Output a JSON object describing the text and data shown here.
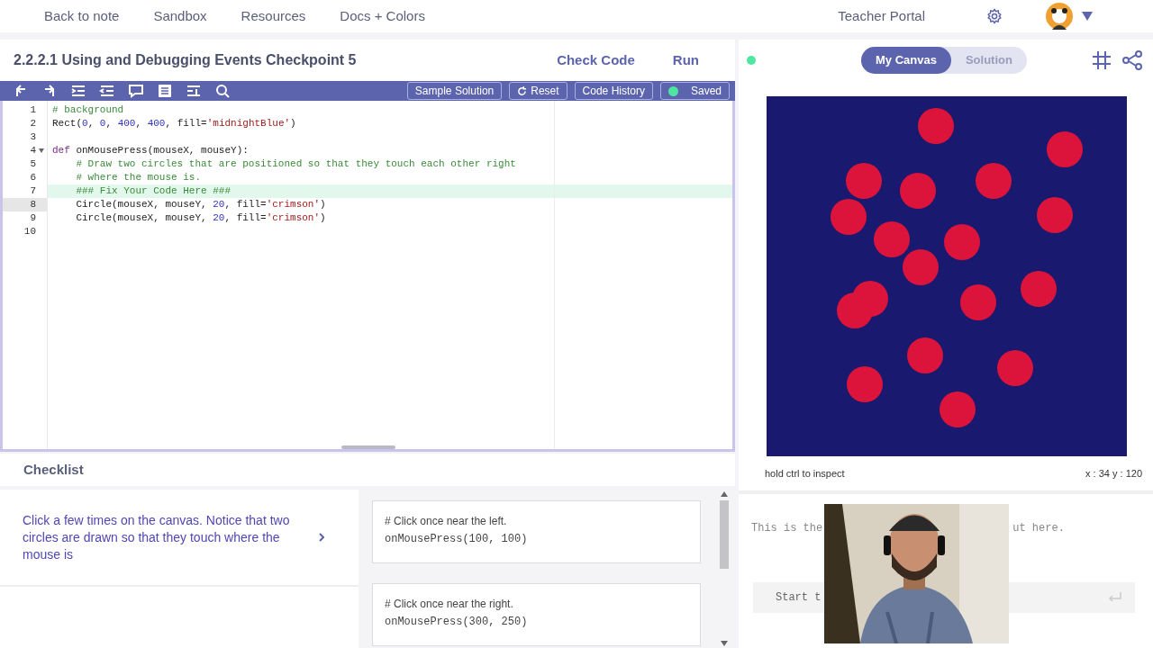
{
  "nav": {
    "links": [
      "Back to note",
      "Sandbox",
      "Resources",
      "Docs + Colors"
    ],
    "teacher_portal": "Teacher Portal"
  },
  "title": "2.2.2.1 Using and Debugging Events Checkpoint 5",
  "actions": [
    "Check Code",
    "Run"
  ],
  "toolbar": {
    "buttons": [
      {
        "label": "Sample Solution",
        "kind": "plain"
      },
      {
        "label": "Reset",
        "kind": "reset"
      },
      {
        "label": "Code History",
        "kind": "plain"
      },
      {
        "label": "Saved",
        "kind": "status"
      }
    ]
  },
  "editor": {
    "lines": [
      {
        "number": "1",
        "highlighted": false,
        "current": false,
        "foldable": false,
        "segments": [
          {
            "t": "# background",
            "kind": "comment"
          }
        ]
      },
      {
        "number": "2",
        "highlighted": false,
        "current": false,
        "foldable": false,
        "segments": [
          {
            "t": "Rect(",
            "kind": "plain"
          },
          {
            "t": "0",
            "kind": "number"
          },
          {
            "t": ", ",
            "kind": "plain"
          },
          {
            "t": "0",
            "kind": "number"
          },
          {
            "t": ", ",
            "kind": "plain"
          },
          {
            "t": "400",
            "kind": "number"
          },
          {
            "t": ", ",
            "kind": "plain"
          },
          {
            "t": "400",
            "kind": "number"
          },
          {
            "t": ", fill=",
            "kind": "plain"
          },
          {
            "t": "'midnightBlue'",
            "kind": "string"
          },
          {
            "t": ")",
            "kind": "plain"
          }
        ]
      },
      {
        "number": "3",
        "highlighted": false,
        "current": false,
        "foldable": false
      },
      {
        "number": "4",
        "highlighted": false,
        "current": false,
        "foldable": true,
        "segments": [
          {
            "t": "def",
            "kind": "keyword"
          },
          {
            "t": " onMousePress(mouseX, mouseY):",
            "kind": "plain"
          }
        ]
      },
      {
        "number": "5",
        "highlighted": false,
        "current": false,
        "foldable": false,
        "segments": [
          {
            "t": "    # Draw two circles that are positioned so that they touch each other right",
            "kind": "comment"
          }
        ]
      },
      {
        "number": "6",
        "highlighted": false,
        "current": false,
        "foldable": false,
        "segments": [
          {
            "t": "    # where the mouse is.",
            "kind": "comment"
          }
        ]
      },
      {
        "number": "7",
        "highlighted": true,
        "current": false,
        "foldable": false,
        "segments": [
          {
            "t": "    ### Fix Your Code Here ###",
            "kind": "comment"
          }
        ]
      },
      {
        "number": "8",
        "highlighted": false,
        "current": true,
        "foldable": false,
        "segments": [
          {
            "t": "    Circle(mouseX, mouseY, ",
            "kind": "plain"
          },
          {
            "t": "20",
            "kind": "number"
          },
          {
            "t": ", fill=",
            "kind": "plain"
          },
          {
            "t": "'crimson'",
            "kind": "string"
          },
          {
            "t": ")",
            "kind": "plain"
          }
        ]
      },
      {
        "number": "9",
        "highlighted": false,
        "current": false,
        "foldable": false,
        "segments": [
          {
            "t": "    Circle(mouseX, mouseY, ",
            "kind": "plain"
          },
          {
            "t": "20",
            "kind": "number"
          },
          {
            "t": ", fill=",
            "kind": "plain"
          },
          {
            "t": "'crimson'",
            "kind": "string"
          },
          {
            "t": ")",
            "kind": "plain"
          }
        ]
      },
      {
        "number": "10",
        "highlighted": false,
        "current": false,
        "foldable": false
      }
    ]
  },
  "checklist": {
    "title": "Checklist",
    "items": [
      {
        "text": "Click a few times on the canvas. Notice that two circles are drawn so that they touch where the mouse is"
      }
    ],
    "examples": [
      {
        "comment": "# Click once near the left.",
        "code": "onMousePress(100, 100)"
      },
      {
        "comment": "# Click once near the right.",
        "code": "onMousePress(300, 250)"
      }
    ]
  },
  "canvas_panel": {
    "tabs": [
      {
        "label": "My Canvas",
        "selected": true
      },
      {
        "label": "Solution",
        "selected": false
      }
    ],
    "hint": "hold ctrl to inspect",
    "coords": "x : 34 y : 120"
  },
  "console": {
    "message_start": "This is the",
    "message_end": "ut here.",
    "input": {
      "placeholder": "Start t"
    }
  }
}
